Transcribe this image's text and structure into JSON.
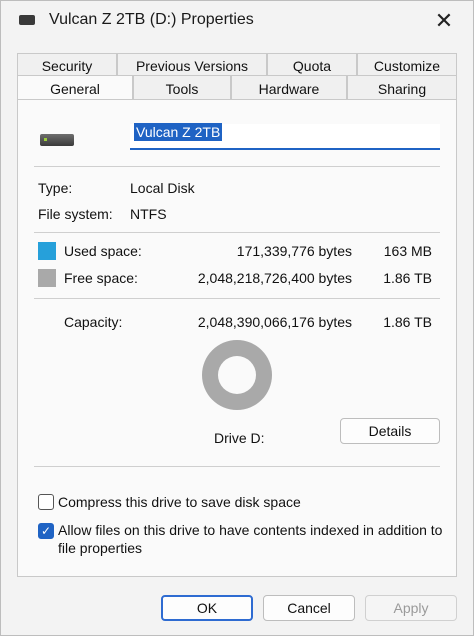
{
  "window": {
    "title": "Vulcan Z 2TB (D:) Properties"
  },
  "tabs_row1": [
    "Security",
    "Previous Versions",
    "Quota",
    "Customize"
  ],
  "tabs_row2": [
    "General",
    "Tools",
    "Hardware",
    "Sharing"
  ],
  "active_tab": "General",
  "drive": {
    "name": "Vulcan Z 2TB"
  },
  "info": {
    "type_label": "Type:",
    "type_value": "Local Disk",
    "fs_label": "File system:",
    "fs_value": "NTFS"
  },
  "space": {
    "used_label": "Used space:",
    "used_bytes": "171,339,776 bytes",
    "used_size": "163 MB",
    "free_label": "Free space:",
    "free_bytes": "2,048,218,726,400 bytes",
    "free_size": "1.86 TB",
    "cap_label": "Capacity:",
    "cap_bytes": "2,048,390,066,176 bytes",
    "cap_size": "1.86 TB",
    "used_color": "#26a0da",
    "free_color": "#a9a9a9"
  },
  "drive_label": "Drive D:",
  "details_button": "Details",
  "options": {
    "compress_label": "Compress this drive to save disk space",
    "compress_checked": false,
    "index_label_line1": "Allow files on this drive to have contents indexed in addition to",
    "index_label_line2": "file properties",
    "index_checked": true
  },
  "footer": {
    "ok": "OK",
    "cancel": "Cancel",
    "apply": "Apply"
  }
}
